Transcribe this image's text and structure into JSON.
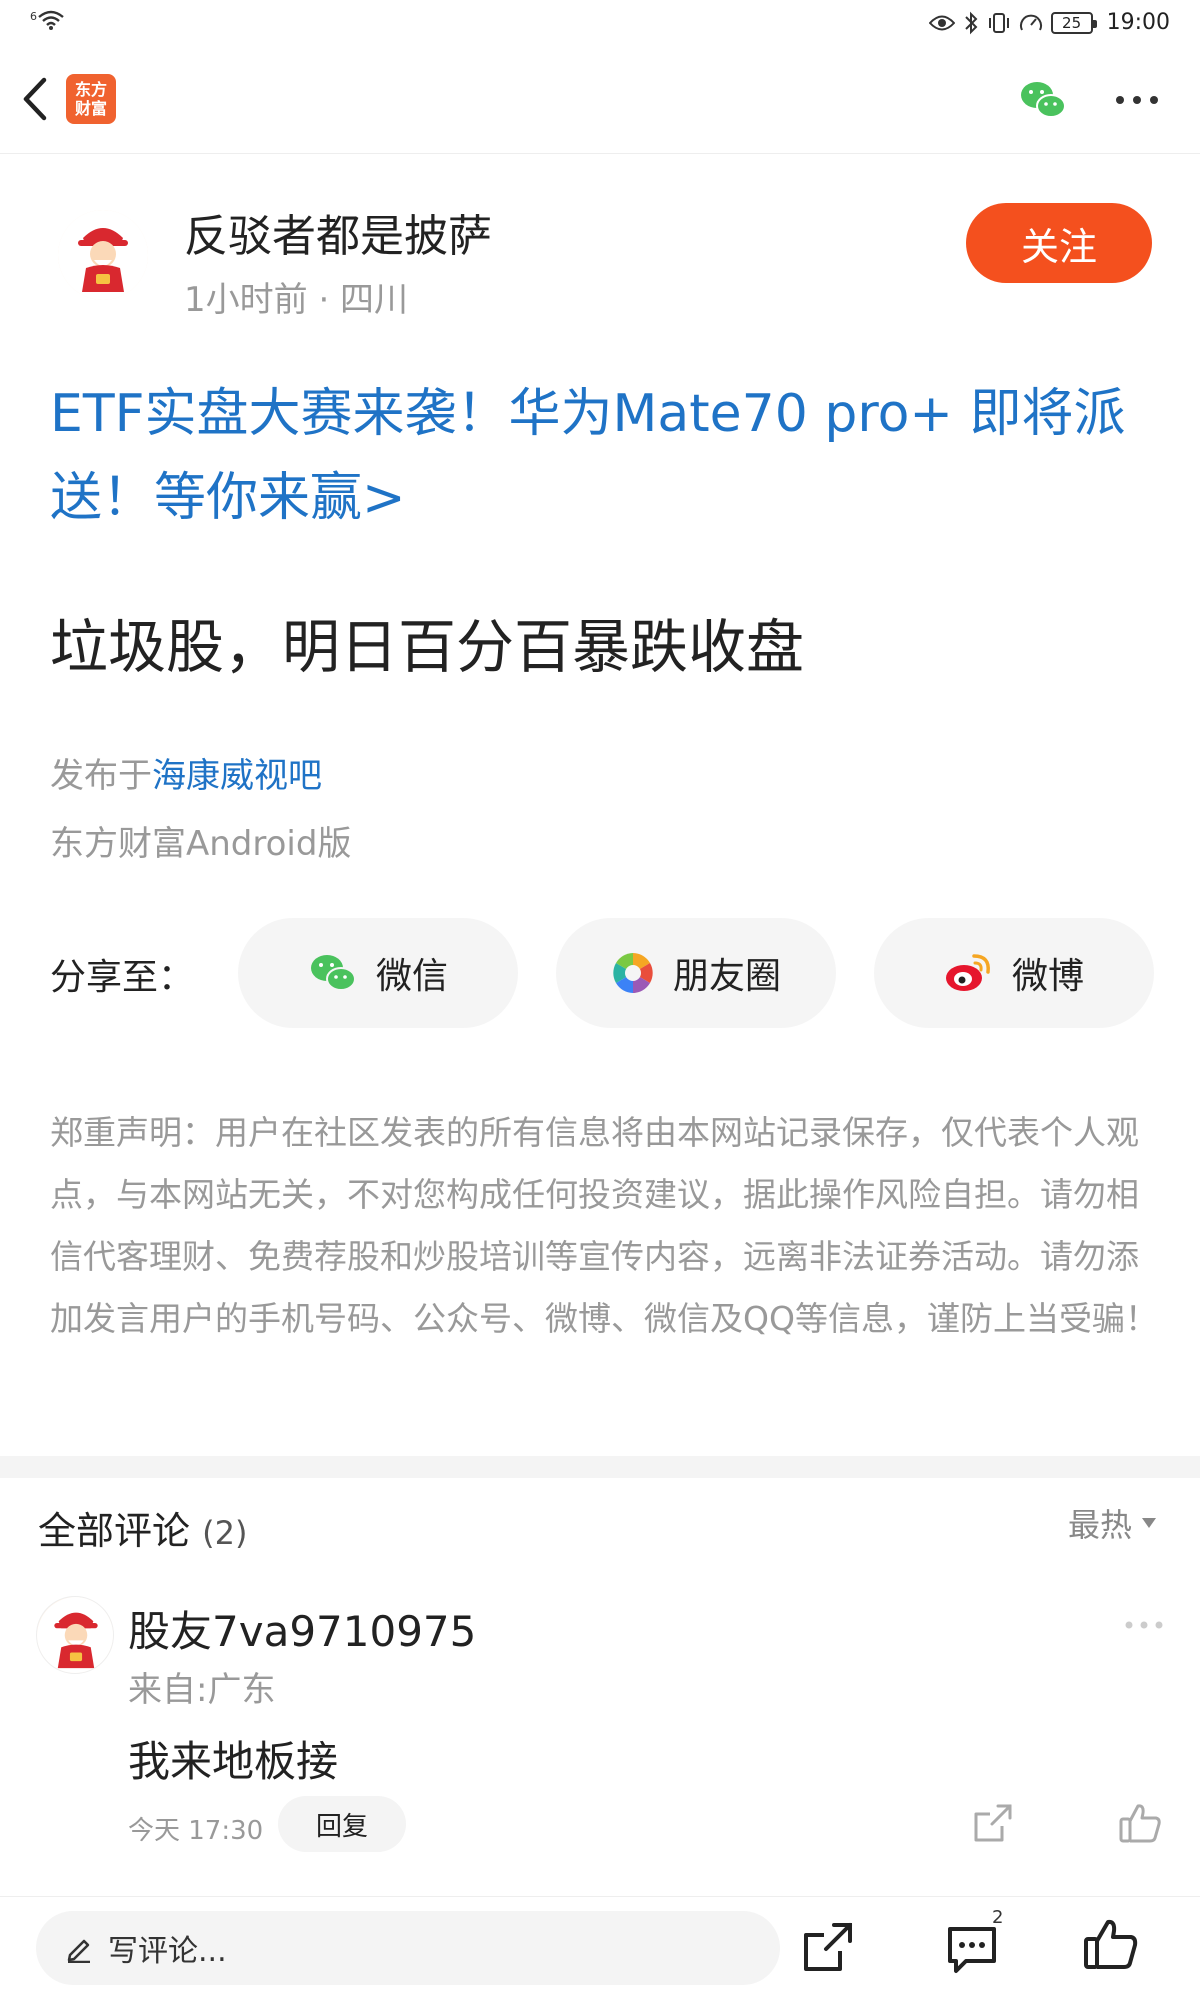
{
  "status_bar": {
    "signal_label": "6",
    "time": "19:00",
    "battery": "25"
  },
  "header": {
    "app_logo_line1": "东方",
    "app_logo_line2": "财富"
  },
  "post": {
    "author_name": "反驳者都是披萨",
    "author_meta": "1小时前 · 四川",
    "follow_label": "关注",
    "promo_link": "ETF实盘大赛来袭！华为Mate70 pro+ 即将派送！等你来赢>",
    "title": "垃圾股，明日百分百暴跌收盘",
    "published_prefix": "发布于",
    "forum_name": "海康威视吧",
    "client": "东方财富Android版"
  },
  "share": {
    "label": "分享至：",
    "wechat": "微信",
    "moments": "朋友圈",
    "weibo": "微博"
  },
  "disclaimer": "郑重声明：用户在社区发表的所有信息将由本网站记录保存，仅代表个人观点，与本网站无关，不对您构成任何投资建议，据此操作风险自担。请勿相信代客理财、免费荐股和炒股培训等宣传内容，远离非法证券活动。请勿添加发言用户的手机号码、公众号、微博、微信及QQ等信息，谨防上当受骗！",
  "comments": {
    "title": "全部评论",
    "count": "(2)",
    "sort": "最热",
    "items": [
      {
        "user": "股友7va9710975",
        "location": "来自:广东",
        "text": "我来地板接",
        "time": "今天 17:30",
        "reply_label": "回复"
      }
    ]
  },
  "bottom_bar": {
    "placeholder": "写评论...",
    "comment_count": "2"
  },
  "colors": {
    "accent_orange": "#f4501e",
    "link_blue": "#1f73c6",
    "wechat_green": "#4ac25d",
    "weibo_red": "#e6162d"
  }
}
